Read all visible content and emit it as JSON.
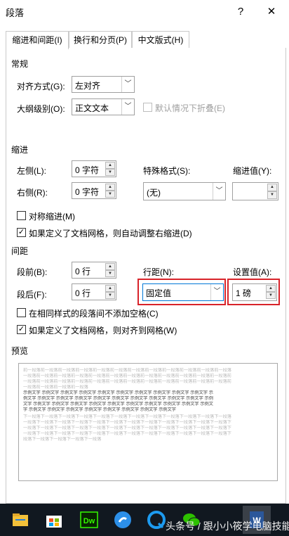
{
  "window": {
    "title": "段落",
    "help": "?",
    "close": "✕"
  },
  "tabs": [
    {
      "label": "缩进和间距(I)"
    },
    {
      "label": "换行和分页(P)"
    },
    {
      "label": "中文版式(H)"
    }
  ],
  "general": {
    "section": "常规",
    "alignment_label": "对齐方式(G):",
    "alignment_value": "左对齐",
    "outline_label": "大纲级别(O):",
    "outline_value": "正文文本",
    "collapse_label": "默认情况下折叠(E)"
  },
  "indent": {
    "section": "缩进",
    "left_label": "左侧(L):",
    "left_value": "0 字符",
    "right_label": "右侧(R):",
    "right_value": "0 字符",
    "special_label": "特殊格式(S):",
    "special_value": "(无)",
    "by_label": "缩进值(Y):",
    "by_value": "",
    "mirror_label": "对称缩进(M)",
    "auto_adjust_label": "如果定义了文档网格，则自动调整右缩进(D)"
  },
  "spacing": {
    "section": "间距",
    "before_label": "段前(B):",
    "before_value": "0 行",
    "after_label": "段后(F):",
    "after_value": "0 行",
    "line_label": "行距(N):",
    "line_value": "固定值",
    "at_label": "设置值(A):",
    "at_value": "1 磅",
    "no_space_label": "在相同样式的段落间不添加空格(C)",
    "snap_grid_label": "如果定义了文档网格，则对齐到网格(W)"
  },
  "preview": {
    "section": "预览",
    "prev_lines": [
      "前一段落前一段落前一段落前一段落前一段落前一段落前一段落前一段落前一段落前一段落前一段落前一段落",
      "一段落前一段落前一段落前一段落前一段落前一段落前一段落前一段落前一段落前一段落前一段落前一段落前",
      "一段落前一段落前一段落前一段落前一段落前一段落前一段落前一段落前一段落前一段落前一段落前一段落前",
      "一段落前一段落前一段落前一段落"
    ],
    "sample_lines": [
      "示例文字 示例文字 示例文字 示例文字 示例文字 示例文字 示例文字 示例文字 示例文字 示例文字 示",
      "例文字 示例文字 示例文字 示例文字 示例文字 示例文字 示例文字 示例文字 示例文字 示例文字 示例",
      "文字 示例文字 示例文字 示例文字 示例文字 示例文字 示例文字 示例文字 示例文字 示例文字 示例文",
      "字 示例文字 示例文字 示例文字 示例文字 示例文字 示例文字 示例文字 示例文字"
    ],
    "next_lines": [
      "下一段落下一段落下一段落下一段落下一段落下一段落下一段落下一段落下一段落下一段落下一段落下一段落",
      "一段落下一段落下一段落下一段落下一段落下一段落下一段落下一段落下一段落下一段落下一段落下一段落下",
      "一段落下一段落下一段落下一段落下一段落下一段落下一段落下一段落下一段落下一段落下一段落下一段落下",
      "一段落下一段落下一段落下一段落下一段落下一段落下一段落下一段落下一段落下一段落下一段落下一段落下",
      "段落下一段落下一段落下一段落下一段落"
    ]
  },
  "taskbar": {
    "dw_label": "Dw",
    "watermark": "头条号 / 跟小小筱学电脑技能"
  },
  "colors": {
    "highlight": "#d8232a",
    "taskbar": "#111820",
    "selection": "#0078d7"
  },
  "icons": [
    "question-icon",
    "close-icon",
    "chevron-down-icon",
    "spin-up-icon",
    "spin-down-icon",
    "checkmark-icon",
    "file-explorer-icon",
    "store-icon",
    "dreamweaver-icon",
    "sogou-icon",
    "qq-browser-icon",
    "wechat-icon",
    "word-icon"
  ]
}
